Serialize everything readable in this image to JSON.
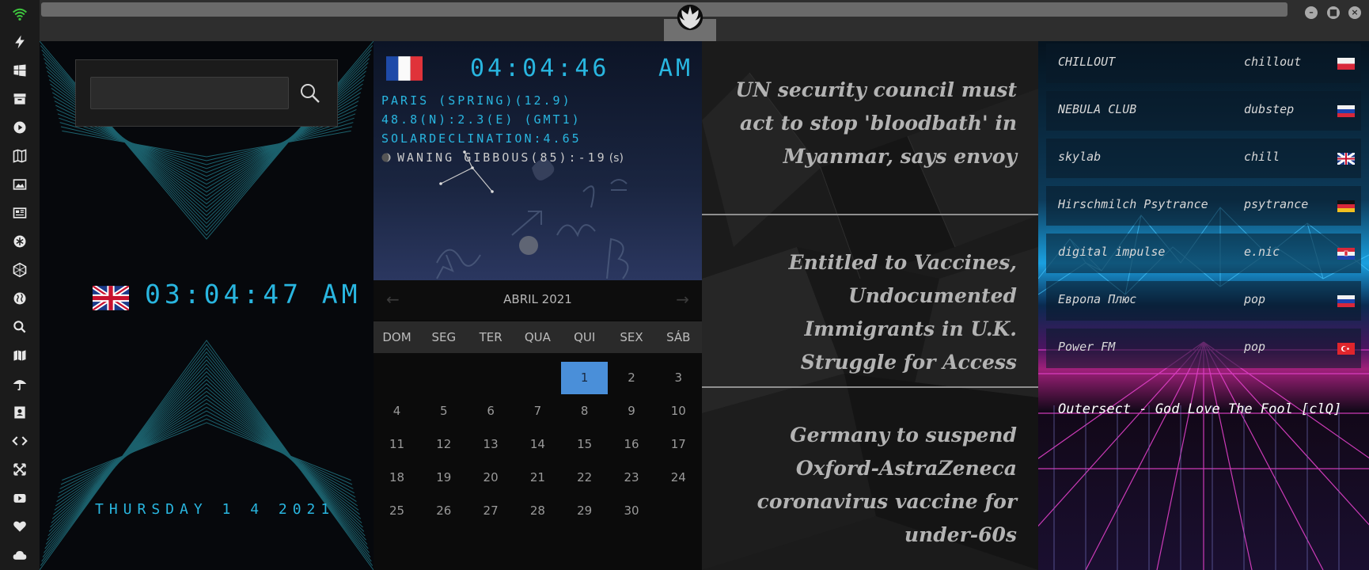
{
  "window": {
    "minimize_label": "–",
    "maximize_label": "■",
    "close_label": "×"
  },
  "sidebar": {
    "icons": [
      "wifi-icon",
      "lightning-icon",
      "windows-icon",
      "archive-icon",
      "play-icon",
      "map-book-icon",
      "image-icon",
      "newspaper-icon",
      "snowflake-icon",
      "hexagon-icon",
      "globe-icon",
      "search-icon",
      "map-icon",
      "umbrella-icon",
      "contacts-icon",
      "code-icon",
      "expand-icon",
      "youtube-icon",
      "heart-icon",
      "cloud-icon"
    ],
    "wifi_color": "#3ec43e"
  },
  "search": {
    "placeholder": "",
    "value": ""
  },
  "clock": {
    "time": "03:04:47 AM",
    "date": "THURSDAY 1 4 2021"
  },
  "astro": {
    "time": "04:04:46",
    "ampm": "AM",
    "line1": "PARIS (SPRING)(12.9)",
    "line2": "48.8(N):2.3(E) (GMT1)",
    "line3": "SOLARDECLINATION:4.65",
    "moon": "WANING GIBBOUS(85):-19",
    "moon_unit": "(s)"
  },
  "calendar": {
    "title": "ABRIL 2021",
    "prev": "←",
    "next": "→",
    "dow": [
      "DOM",
      "SEG",
      "TER",
      "QUA",
      "QUI",
      "SEX",
      "SÁB"
    ],
    "first_weekday": 4,
    "days_in_month": 30,
    "selected_day": 1
  },
  "news": {
    "items": [
      "UN security council must act to stop 'bloodbath' in Myanmar, says envoy",
      "Entitled to Vaccines, Undocumented Immigrants in U.K. Struggle for Access",
      "Germany to suspend Oxford-AstraZeneca coronavirus vaccine for under-60s"
    ]
  },
  "radio": {
    "stations": [
      {
        "name": "CHILLOUT",
        "genre": "chillout",
        "flag": "pl"
      },
      {
        "name": "NEBULA CLUB",
        "genre": "dubstep",
        "flag": "ru"
      },
      {
        "name": "skylab",
        "genre": "chill",
        "flag": "uk"
      },
      {
        "name": "Hirschmilch Psytrance",
        "genre": "psytrance",
        "flag": "de"
      },
      {
        "name": "digital impulse",
        "genre": "e.nic",
        "flag": "hr"
      },
      {
        "name": "Европа Плюс",
        "genre": "pop",
        "flag": "ru"
      },
      {
        "name": "Power FM",
        "genre": "pop",
        "flag": "tr"
      }
    ],
    "now_playing": "Outersect - God Love The Fool [clQ]"
  },
  "colors": {
    "accent": "#29b6e0",
    "calendar_selected": "#4a8fd9"
  }
}
